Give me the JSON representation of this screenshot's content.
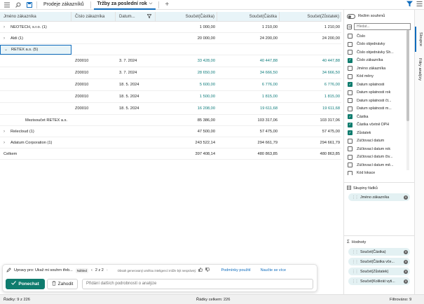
{
  "tabs": {
    "tab1": "Prodeje zákazníků",
    "tab2": "Tržby za poslední rok"
  },
  "grid": {
    "headers": [
      "Jméno zákazníka",
      "Číslo zákazníka",
      "Datum...",
      "Součet(Částka)",
      "Součet(Částka",
      "Součet(Zůstatek)"
    ],
    "rows": [
      {
        "c1": "NEOTECH, s.r.o. (1)",
        "c2": "",
        "c3": "",
        "c4": "1 000,00",
        "c5": "1 210,00",
        "c6": "1 210,00"
      },
      {
        "c1": "Aldi (1)",
        "c2": "",
        "c3": "",
        "c4": "20 000,00",
        "c5": "24 200,00",
        "c6": "24 200,00"
      },
      {
        "c1": "RETEX a.s. (5)",
        "c2": "",
        "c3": "",
        "c4": "",
        "c5": "",
        "c6": ""
      },
      {
        "c1": "",
        "c2": "Z00010",
        "c3": "3. 7. 2024",
        "c4": "33 428,00",
        "c5": "40 447,88",
        "c6": "40 447,88"
      },
      {
        "c1": "",
        "c2": "Z00010",
        "c3": "3. 7. 2024",
        "c4": "28 650,00",
        "c5": "34 666,50",
        "c6": "34 666,50"
      },
      {
        "c1": "",
        "c2": "Z00010",
        "c3": "18. 5. 2024",
        "c4": "5 600,00",
        "c5": "6 776,00",
        "c6": "6 776,00"
      },
      {
        "c1": "",
        "c2": "Z00010",
        "c3": "18. 5. 2024",
        "c4": "1 500,00",
        "c5": "1 815,00",
        "c6": "1 815,00"
      },
      {
        "c1": "",
        "c2": "Z00010",
        "c3": "18. 5. 2024",
        "c4": "16 208,00",
        "c5": "19 611,68",
        "c6": "19 611,68"
      },
      {
        "c1": "Mezisoučet RETEX a.s.",
        "c2": "",
        "c3": "",
        "c4": "85 386,00",
        "c5": "103 317,06",
        "c6": "103 317,06"
      },
      {
        "c1": "Relecloud (1)",
        "c2": "",
        "c3": "",
        "c4": "47 500,00",
        "c5": "57 475,00",
        "c6": "57 475,00"
      },
      {
        "c1": "Adatum Corporation (1)",
        "c2": "",
        "c3": "",
        "c4": "243 522,14",
        "c5": "294 661,79",
        "c6": "294 661,79"
      },
      {
        "c1": "Celkem",
        "c2": "",
        "c3": "",
        "c4": "397 408,14",
        "c5": "480 863,85",
        "c6": "480 863,85"
      }
    ]
  },
  "chat": {
    "prompt": "Upravy pro: Ukaž mi souhrn třeb...",
    "badge": "Náhled",
    "pager": "2 z 2",
    "disclaimer": "Obsah generovaný umělou inteligencí může být nesprávný",
    "terms": "Podmínky použití",
    "learn": "Naučte se více",
    "keep": "Ponechat",
    "discard": "Zahodit",
    "placeholder": "Přidání dalších podrobností o analýze"
  },
  "status": {
    "rows": "Řádky: 9 z 226",
    "total": "Řádky celkem: 226",
    "filtered": "Filtrováno: 9"
  },
  "panel": {
    "pivot_mode": "Režim souhrnů",
    "search": "Hledat...",
    "fields": [
      {
        "label": "Číslo",
        "checked": false
      },
      {
        "label": "Číslo objednávky",
        "checked": false
      },
      {
        "label": "Číslo objednávky Sh...",
        "checked": false
      },
      {
        "label": "Číslo zákazníka",
        "checked": true
      },
      {
        "label": "Jméno zákazníka",
        "checked": false
      },
      {
        "label": "Kód měny",
        "checked": false
      },
      {
        "label": "Datum splatnosti",
        "checked": true
      },
      {
        "label": "Datum splatnosti rok",
        "checked": false
      },
      {
        "label": "Datum splatnosti čt...",
        "checked": false
      },
      {
        "label": "Datum splatnosti m...",
        "checked": false
      },
      {
        "label": "Částka",
        "checked": true
      },
      {
        "label": "Částka včetně DPH",
        "checked": true
      },
      {
        "label": "Zůstatek",
        "checked": true
      },
      {
        "label": "Zúčtovací datum",
        "checked": false
      },
      {
        "label": "Zúčtovací datum rok",
        "checked": false
      },
      {
        "label": "Zúčtovací datum čtv...",
        "checked": false
      },
      {
        "label": "Zúčtovací datum mě...",
        "checked": false
      },
      {
        "label": "Kód lokace",
        "checked": false
      }
    ],
    "row_groups_title": "Skupiny řádků",
    "row_groups": [
      "Jméno zákazníka"
    ],
    "values_title": "Hodnoty",
    "values": [
      "Součet(Částka)",
      "Součet(Částka vče...",
      "Součet(Zůstatek)",
      "Součet(Kolikrát vyti..."
    ]
  },
  "vtabs": {
    "columns": "Sloupce",
    "filters": "Filtry analýzy"
  }
}
